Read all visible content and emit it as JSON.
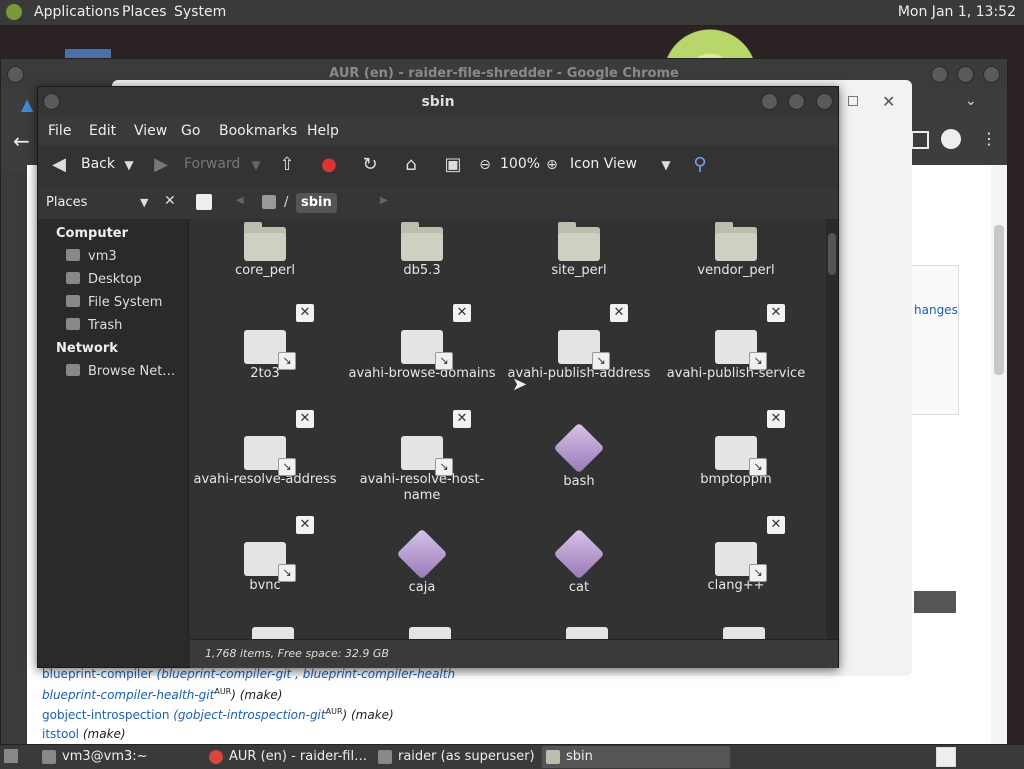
{
  "top_panel": {
    "menus": [
      "Applications",
      "Places",
      "System"
    ],
    "clock": "Mon Jan 1, 13:52"
  },
  "chrome": {
    "title": "AUR (en) - raider-file-shredder - Google Chrome",
    "changes_link": "hanges",
    "lines": [
      {
        "a": "blueprint-compiler",
        "b": "(blueprint-compiler-git",
        "c": ", blueprint-compiler-health"
      },
      {
        "a": "blueprint-compiler-health-git",
        "sup": "AUR",
        "rest": ") (make)"
      },
      {
        "a": "gobject-introspection",
        "b": "(gobject-introspection-git",
        "sup": "AUR",
        "rest": ") (make)"
      },
      {
        "a": "itstool",
        "rest": "(make)"
      }
    ]
  },
  "caja": {
    "title": "sbin",
    "menu": [
      "File",
      "Edit",
      "View",
      "Go",
      "Bookmarks",
      "Help"
    ],
    "toolbar": {
      "back": "Back",
      "forward": "Forward",
      "zoom": "100%",
      "view_mode": "Icon View"
    },
    "sidebar": {
      "selector": "Places",
      "computer_heading": "Computer",
      "computer_items": [
        "vm3",
        "Desktop",
        "File System",
        "Trash"
      ],
      "network_heading": "Network",
      "network_items": [
        "Browse Net…"
      ]
    },
    "path": {
      "root": "/",
      "current": "sbin"
    },
    "items": [
      {
        "name": "core_perl",
        "kind": "folder"
      },
      {
        "name": "db5.3",
        "kind": "folder"
      },
      {
        "name": "site_perl",
        "kind": "folder"
      },
      {
        "name": "vendor_perl",
        "kind": "folder"
      },
      {
        "name": "2to3",
        "kind": "link"
      },
      {
        "name": "avahi-browse-domains",
        "kind": "link"
      },
      {
        "name": "avahi-publish-address",
        "kind": "link"
      },
      {
        "name": "avahi-publish-service",
        "kind": "link"
      },
      {
        "name": "avahi-resolve-address",
        "kind": "link"
      },
      {
        "name": "avahi-resolve-host-name",
        "kind": "link"
      },
      {
        "name": "bash",
        "kind": "exe"
      },
      {
        "name": "bmptoppm",
        "kind": "link"
      },
      {
        "name": "bvnc",
        "kind": "link"
      },
      {
        "name": "caja",
        "kind": "exe"
      },
      {
        "name": "cat",
        "kind": "exe"
      },
      {
        "name": "clang++",
        "kind": "link"
      }
    ],
    "status": "1,768 items, Free space: 32.9 GB"
  },
  "taskbar": {
    "tasks": [
      "vm3@vm3:~",
      "AUR (en) - raider-fil…",
      "raider (as superuser)",
      "sbin"
    ]
  }
}
